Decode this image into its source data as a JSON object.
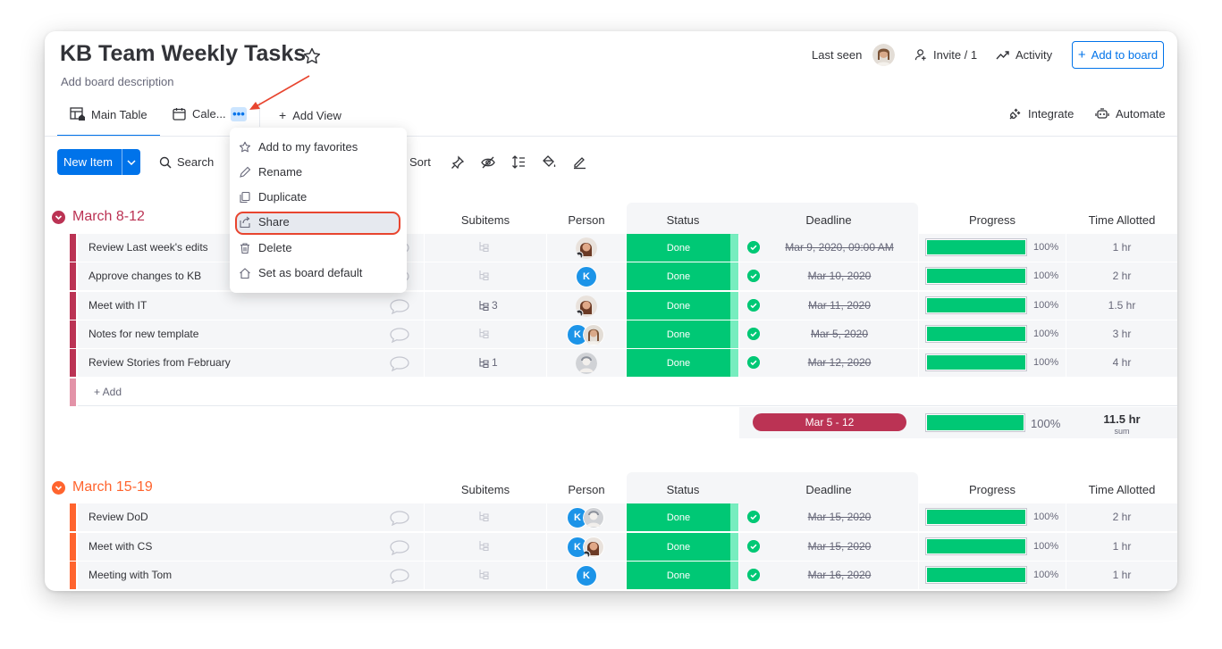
{
  "board": {
    "title": "KB Team Weekly Tasks",
    "description": "Add board description"
  },
  "header": {
    "last_seen": "Last seen",
    "invite": "Invite / 1",
    "activity": "Activity",
    "add_to_board": "Add to board"
  },
  "tabs": [
    {
      "label": "Main Table"
    },
    {
      "label": "Cale..."
    }
  ],
  "add_view": "Add View",
  "right_tabs": {
    "integrate": "Integrate",
    "automate": "Automate"
  },
  "toolbar": {
    "new_item": "New Item",
    "search": "Search",
    "sort": "Sort"
  },
  "menu": {
    "items": [
      {
        "label": "Add to my favorites",
        "icon": "star-icon"
      },
      {
        "label": "Rename",
        "icon": "pencil-icon"
      },
      {
        "label": "Duplicate",
        "icon": "duplicate-icon"
      },
      {
        "label": "Share",
        "icon": "share-icon"
      },
      {
        "label": "Delete",
        "icon": "trash-icon"
      },
      {
        "label": "Set as board default",
        "icon": "home-icon"
      }
    ]
  },
  "columns": {
    "subitems": "Subitems",
    "person": "Person",
    "status": "Status",
    "deadline": "Deadline",
    "progress": "Progress",
    "time": "Time Allotted"
  },
  "groups": [
    {
      "title": "March 8-12",
      "color": "#bb3354",
      "rows": [
        {
          "name": "Review Last week's edits",
          "subitems": "",
          "status": "Done",
          "deadline": "Mar 9, 2020, 09:00 AM",
          "progress": "100%",
          "time": "1 hr"
        },
        {
          "name": "Approve changes to KB",
          "subitems": "",
          "status": "Done",
          "deadline": "Mar 10, 2020",
          "progress": "100%",
          "time": "2 hr"
        },
        {
          "name": "Meet with IT",
          "subitems": "3",
          "status": "Done",
          "deadline": "Mar 11, 2020",
          "progress": "100%",
          "time": "1.5 hr"
        },
        {
          "name": "Notes for new template",
          "subitems": "",
          "status": "Done",
          "deadline": "Mar 5, 2020",
          "progress": "100%",
          "time": "3 hr"
        },
        {
          "name": "Review Stories from February",
          "subitems": "1",
          "status": "Done",
          "deadline": "Mar 12, 2020",
          "progress": "100%",
          "time": "4 hr"
        }
      ],
      "add_label": "+ Add",
      "summary": {
        "range": "Mar 5 - 12",
        "progress": "100%",
        "time": "11.5 hr",
        "time_sub": "sum"
      }
    },
    {
      "title": "March 15-19",
      "color": "#ff642e",
      "rows": [
        {
          "name": "Review DoD",
          "subitems": "",
          "status": "Done",
          "deadline": "Mar 15, 2020",
          "progress": "100%",
          "time": "2 hr"
        },
        {
          "name": "Meet with CS",
          "subitems": "",
          "status": "Done",
          "deadline": "Mar 15, 2020",
          "progress": "100%",
          "time": "1 hr"
        },
        {
          "name": "Meeting with Tom",
          "subitems": "",
          "status": "Done",
          "deadline": "Mar 16, 2020",
          "progress": "100%",
          "time": "1 hr"
        }
      ]
    }
  ],
  "avatar_letter": "K",
  "colors": {
    "accent": "#0073ea",
    "done": "#00c875",
    "annotation": "#e8452f"
  }
}
